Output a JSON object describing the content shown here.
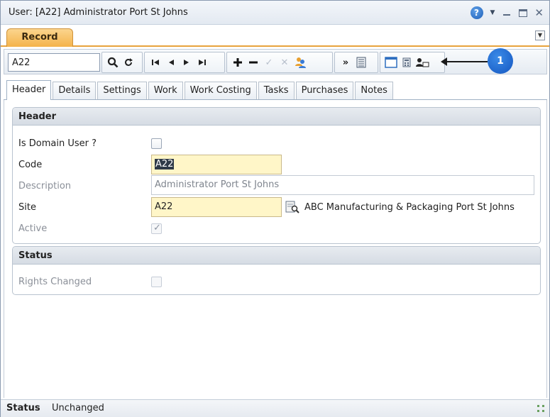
{
  "window": {
    "title": "User: [A22] Administrator Port St Johns"
  },
  "record_tab": {
    "label": "Record"
  },
  "toolbar": {
    "code_value": "A22",
    "icons": [
      "search-icon",
      "refresh-icon",
      "first-record-icon",
      "previous-record-icon",
      "next-record-icon",
      "last-record-icon",
      "add-icon",
      "remove-icon",
      "save-icon",
      "cancel-icon",
      "users-icon",
      "more-icon",
      "form-view-icon",
      "window-icon",
      "calculator-icon",
      "user-card-icon"
    ]
  },
  "callout": {
    "number": "1"
  },
  "tabs": [
    {
      "label": "Header",
      "active": true
    },
    {
      "label": "Details"
    },
    {
      "label": "Settings"
    },
    {
      "label": "Work"
    },
    {
      "label": "Work Costing"
    },
    {
      "label": "Tasks"
    },
    {
      "label": "Purchases"
    },
    {
      "label": "Notes"
    }
  ],
  "header_section": {
    "title": "Header",
    "is_domain_user_label": "Is Domain User ?",
    "is_domain_user_checked": false,
    "code_label": "Code",
    "code_value": "A22",
    "description_label": "Description",
    "description_value": "Administrator Port St Johns",
    "site_label": "Site",
    "site_value": "A22",
    "site_description": "ABC Manufacturing & Packaging Port St Johns",
    "active_label": "Active",
    "active_checked": true
  },
  "status_section": {
    "title": "Status",
    "rights_changed_label": "Rights Changed",
    "rights_changed_checked": false
  },
  "statusbar": {
    "label": "Status",
    "value": "Unchanged"
  },
  "colors": {
    "accent_tab": "#f4b34a",
    "required_field": "#fff6c8",
    "callout_badge": "#1456c0"
  }
}
